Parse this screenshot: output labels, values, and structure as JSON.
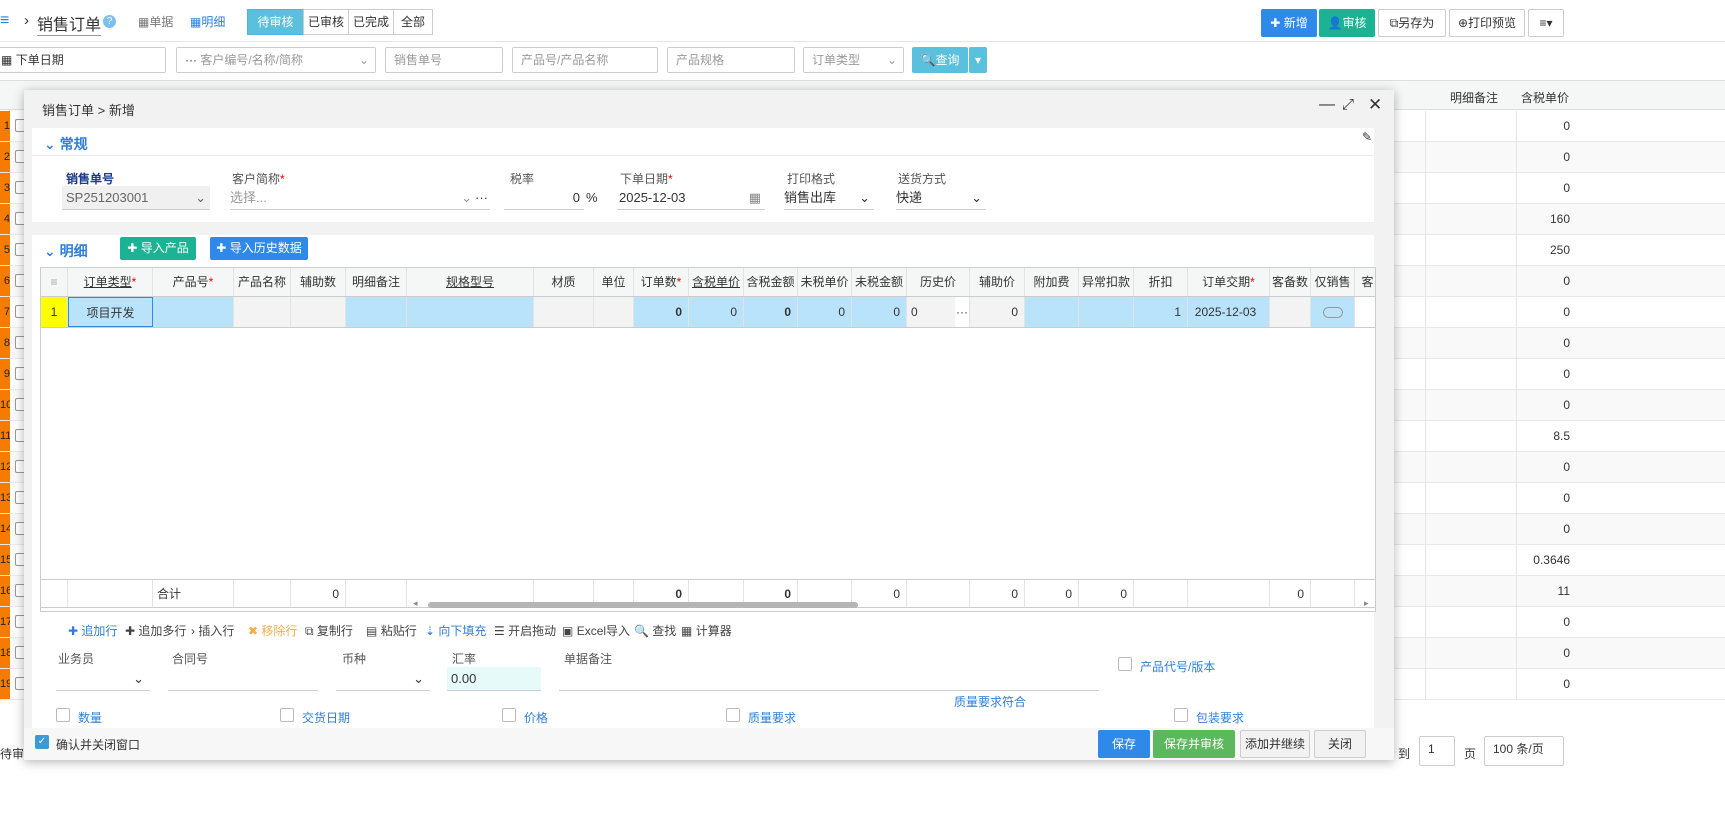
{
  "header": {
    "title": "销售订单",
    "view_tabs": [
      {
        "label": "单据",
        "icon": "grid-icon"
      },
      {
        "label": "明细",
        "icon": "table-icon"
      }
    ],
    "status_tabs": [
      "待审核",
      "已审核",
      "已完成",
      "全部"
    ],
    "active_status": "待审核",
    "actions": {
      "add": "新增",
      "approve": "审核",
      "save_as": "另存为",
      "print_preview": "打印预览"
    }
  },
  "filters": {
    "date": "下单日期",
    "customer_placeholder": "客户编号/名称/简称",
    "order_no_placeholder": "销售单号",
    "product_placeholder": "产品号/产品名称",
    "spec_placeholder": "产品规格",
    "order_type_placeholder": "订单类型",
    "query": "查询"
  },
  "background_table": {
    "headers": [
      "明细备注",
      "含税单价"
    ],
    "row_numbers": [
      "1",
      "2",
      "3",
      "4",
      "5",
      "6",
      "7",
      "8",
      "9",
      "10",
      "11",
      "12",
      "13",
      "14",
      "15",
      "16",
      "17",
      "18",
      "19"
    ],
    "unit_prices": [
      "0",
      "0",
      "0",
      "160",
      "250",
      "0",
      "0",
      "0",
      "0",
      "0",
      "8.5",
      "0",
      "0",
      "0",
      "0.3646",
      "11",
      "0",
      "0",
      "0"
    ]
  },
  "footer_bar": {
    "status": "待审",
    "goto": "到",
    "page": "1",
    "page_unit": "页",
    "page_size": "100 条/页"
  },
  "modal": {
    "title": "销售订单 > 新增",
    "general": {
      "section": "常规",
      "fields": {
        "order_no_label": "销售单号",
        "order_no": "SP251203001",
        "customer_label": "客户简称",
        "customer_placeholder": "选择...",
        "tax_label": "税率",
        "tax": "0",
        "tax_unit": "%",
        "date_label": "下单日期",
        "date": "2025-12-03",
        "print_label": "打印格式",
        "print": "销售出库",
        "ship_label": "送货方式",
        "ship": "快递"
      }
    },
    "detail": {
      "section": "明细",
      "import_product": "导入产品",
      "import_history": "导入历史数据",
      "columns": [
        "订单类型",
        "产品号",
        "产品名称",
        "辅助数",
        "明细备注",
        "规格型号",
        "材质",
        "单位",
        "订单数",
        "含税单价",
        "含税金额",
        "未税单价",
        "未税金额",
        "历史价",
        "辅助价",
        "附加费",
        "异常扣款",
        "折扣",
        "订单交期",
        "客备数",
        "仅销售",
        "客"
      ],
      "required": [
        "订单类型",
        "产品号",
        "订单数",
        "订单交期"
      ],
      "row": {
        "index": "1",
        "cells": [
          "项目开发",
          "",
          "",
          "",
          "",
          "",
          "",
          "",
          "0",
          "0",
          "0",
          "0",
          "0",
          "0",
          "0",
          "",
          "",
          "1",
          "2025-12-03",
          "",
          ""
        ]
      },
      "totals": {
        "label": "合计",
        "cells": [
          "",
          "",
          "",
          "0",
          "",
          "",
          "",
          "",
          "0",
          "",
          "0",
          "",
          "0",
          "",
          "0",
          "0",
          "0",
          "",
          "",
          "0",
          "",
          ""
        ]
      }
    },
    "toolbar": [
      "追加行",
      "追加多行",
      "插入行",
      "移除行",
      "复制行",
      "粘贴行",
      "向下填充",
      "开启拖动",
      "Excel导入",
      "查找",
      "计算器"
    ],
    "extra": {
      "sales_label": "业务员",
      "contract_label": "合同号",
      "currency_label": "币种",
      "rate_label": "汇率",
      "rate": "0.00",
      "remark_label": "单据备注",
      "product_code": "产品代号/版本",
      "checks": [
        "数量",
        "交货日期",
        "价格",
        "质量要求",
        "包装要求"
      ],
      "quality_match": "质量要求符合"
    },
    "footer": {
      "confirm_close": "确认并关闭窗口",
      "save": "保存",
      "save_approve": "保存并审核",
      "add_continue": "添加并继续",
      "close": "关闭"
    }
  },
  "colors": {
    "primary": "#2f89e8",
    "teal": "#1bb394",
    "green": "#5cb85c",
    "active_tab": "#5bc0de",
    "orange": "#f57c00",
    "selected_row": "#b9e3fb",
    "highlight": "#ffff00"
  }
}
